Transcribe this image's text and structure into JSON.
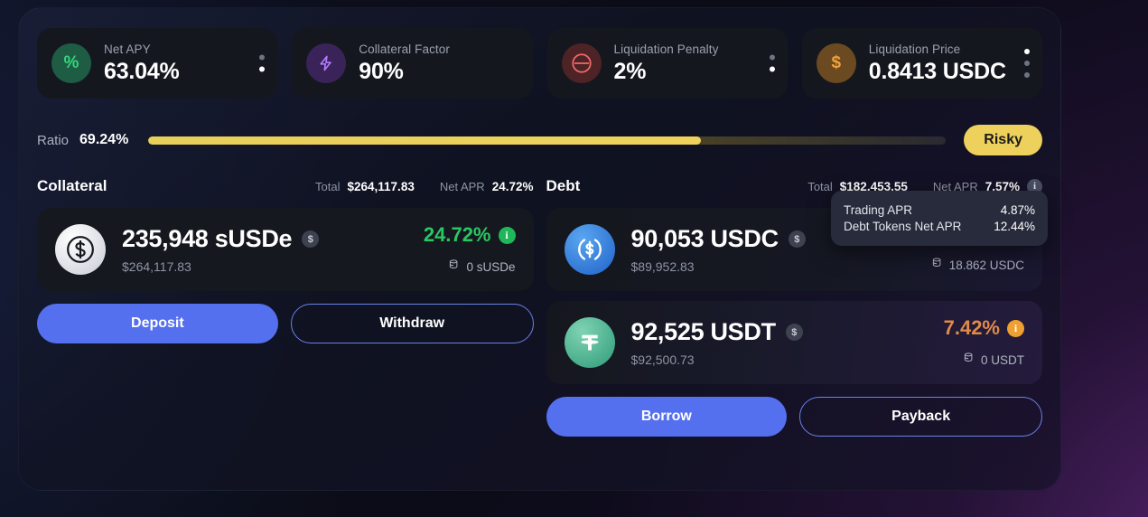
{
  "stats": [
    {
      "icon": "percent-icon",
      "glyph": "%",
      "label": "Net APY",
      "value": "63.04%",
      "tone": "green",
      "dots": [
        "dim",
        "bright"
      ]
    },
    {
      "icon": "bolt-icon",
      "glyph": "⚡",
      "label": "Collateral Factor",
      "value": "90%",
      "tone": "purple",
      "dots": []
    },
    {
      "icon": "minus-circle-icon",
      "glyph": "⊖",
      "label": "Liquidation Penalty",
      "value": "2%",
      "tone": "red",
      "dots": [
        "dim",
        "bright"
      ]
    },
    {
      "icon": "dollar-icon",
      "glyph": "$",
      "label": "Liquidation Price",
      "value": "0.8413 USDC",
      "tone": "orange",
      "dots": [
        "bright",
        "dim",
        "dim"
      ]
    }
  ],
  "ratio": {
    "label": "Ratio",
    "value": "69.24%",
    "percent": 69.24,
    "fill_percent": 69.24,
    "badge": "Risky",
    "badge_color": "#edd15c"
  },
  "collateral": {
    "title": "Collateral",
    "total_label": "Total",
    "total_value": "$264,117.83",
    "apr_label": "Net APR",
    "apr_value": "24.72%",
    "assets": [
      {
        "icon": "susde-coin-icon",
        "amount": "235,948 sUSDe",
        "usd": "$264,117.83",
        "apr": "24.72%",
        "apr_tone": "green",
        "wallet": "0 sUSDe",
        "badge": "$"
      }
    ],
    "buttons": {
      "primary": "Deposit",
      "secondary": "Withdraw"
    }
  },
  "debt": {
    "title": "Debt",
    "total_label": "Total",
    "total_value": "$182,453.55",
    "apr_label": "Net APR",
    "apr_value": "7.57%",
    "assets": [
      {
        "icon": "usdc-coin-icon",
        "amount": "90,053 USDC",
        "usd": "$89,952.83",
        "apr": "",
        "apr_tone": "none",
        "wallet": "18.862 USDC",
        "badge": "$"
      },
      {
        "icon": "usdt-coin-icon",
        "amount": "92,525 USDT",
        "usd": "$92,500.73",
        "apr": "7.42%",
        "apr_tone": "orange",
        "wallet": "0 USDT",
        "badge": "$"
      }
    ],
    "buttons": {
      "primary": "Borrow",
      "secondary": "Payback"
    }
  },
  "tooltip": {
    "rows": [
      {
        "label": "Trading APR",
        "value": "4.87%"
      },
      {
        "label": "Debt Tokens Net APR",
        "value": "12.44%"
      }
    ]
  }
}
